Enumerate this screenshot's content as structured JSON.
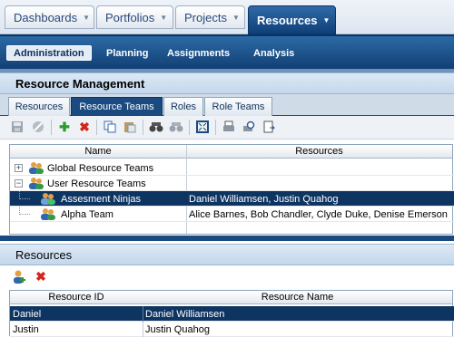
{
  "top_nav": {
    "tabs": [
      {
        "label": "Dashboards"
      },
      {
        "label": "Portfolios"
      },
      {
        "label": "Projects"
      },
      {
        "label": "Resources"
      }
    ],
    "active": "Resources"
  },
  "sub_nav": {
    "items": [
      {
        "label": "Administration"
      },
      {
        "label": "Planning"
      },
      {
        "label": "Assignments"
      },
      {
        "label": "Analysis"
      }
    ],
    "active": "Administration"
  },
  "panel": {
    "title": "Resource Management"
  },
  "tabs": [
    {
      "label": "Resources"
    },
    {
      "label": "Resource Teams"
    },
    {
      "label": "Roles"
    },
    {
      "label": "Role Teams"
    }
  ],
  "active_tab": "Resource Teams",
  "toolbar": {
    "icons": [
      "save-icon",
      "cancel-icon",
      "add-icon",
      "delete-icon",
      "copy-icon",
      "paste-icon",
      "find-icon",
      "find-next-icon",
      "expand-icon",
      "print-icon",
      "print-preview-icon",
      "export-icon"
    ]
  },
  "teams_table": {
    "headers": {
      "name": "Name",
      "resources": "Resources"
    },
    "rows": [
      {
        "name": "Global Resource Teams",
        "resources": "",
        "expander": "+"
      },
      {
        "name": "User Resource Teams",
        "resources": "",
        "expander": "−"
      },
      {
        "name": "Assesment Ninjas",
        "resources": "Daniel Williamsen, Justin Quahog"
      },
      {
        "name": "Alpha Team",
        "resources": "Alice Barnes, Bob Chandler, Clyde Duke, Denise Emerson"
      }
    ]
  },
  "resources_panel": {
    "title": "Resources",
    "headers": {
      "id": "Resource ID",
      "name": "Resource Name"
    },
    "rows": [
      {
        "id": "Daniel",
        "name": "Daniel Williamsen"
      },
      {
        "id": "Justin",
        "name": "Justin Quahog"
      }
    ]
  },
  "colors": {
    "nav_blue": "#1a4a80",
    "selected_row": "#0e3562",
    "panel_header": "#cfe0f1"
  }
}
